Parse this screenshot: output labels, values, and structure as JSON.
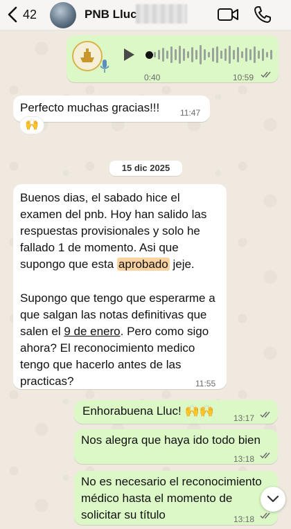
{
  "header": {
    "back_count": "42",
    "contact_name": "PNB Lluc"
  },
  "messages": {
    "voice": {
      "duration": "0:40",
      "time": "10:59"
    },
    "perfecto": {
      "text": "Perfecto muchas gracias!!!",
      "time": "11:47",
      "reaction": "🙌"
    },
    "date_chip": "15 dic 2025",
    "long": {
      "p1_a": "Buenos dias, el sabado hice el examen del pnb. Hoy han salido las respuestas provisionales y solo he fallado 1 de momento. Asi que supongo que esta ",
      "p1_highlight": "aprobado",
      "p1_b": " jeje.",
      "p2_a": "Supongo que tengo que esperarme a que salgan las notas definitivas que salen el ",
      "p2_link": "9 de enero",
      "p2_b": ". Pero como sigo ahora? El reconocimiento medico tengo que hacerlo antes de las practicas?",
      "time": "11:55"
    },
    "enho": {
      "text": "Enhorabuena Lluc! 🙌🙌",
      "time": "13:17"
    },
    "alegra": {
      "text": "Nos alegra que haya ido todo bien",
      "time": "13:18"
    },
    "necesario": {
      "text": "No es necesario el reconocimiento médico hasta el momento de solicitar su título",
      "time": "13:18"
    }
  },
  "colors": {
    "outgoing": "#dcf8c6",
    "incoming": "#ffffff",
    "read_ticks": "#53bdeb",
    "highlight": "#fbd3a0"
  },
  "icons": [
    "chevron-left-icon",
    "video-call-icon",
    "phone-icon",
    "play-icon",
    "mic-icon",
    "double-check-icon",
    "chevron-down-icon"
  ]
}
